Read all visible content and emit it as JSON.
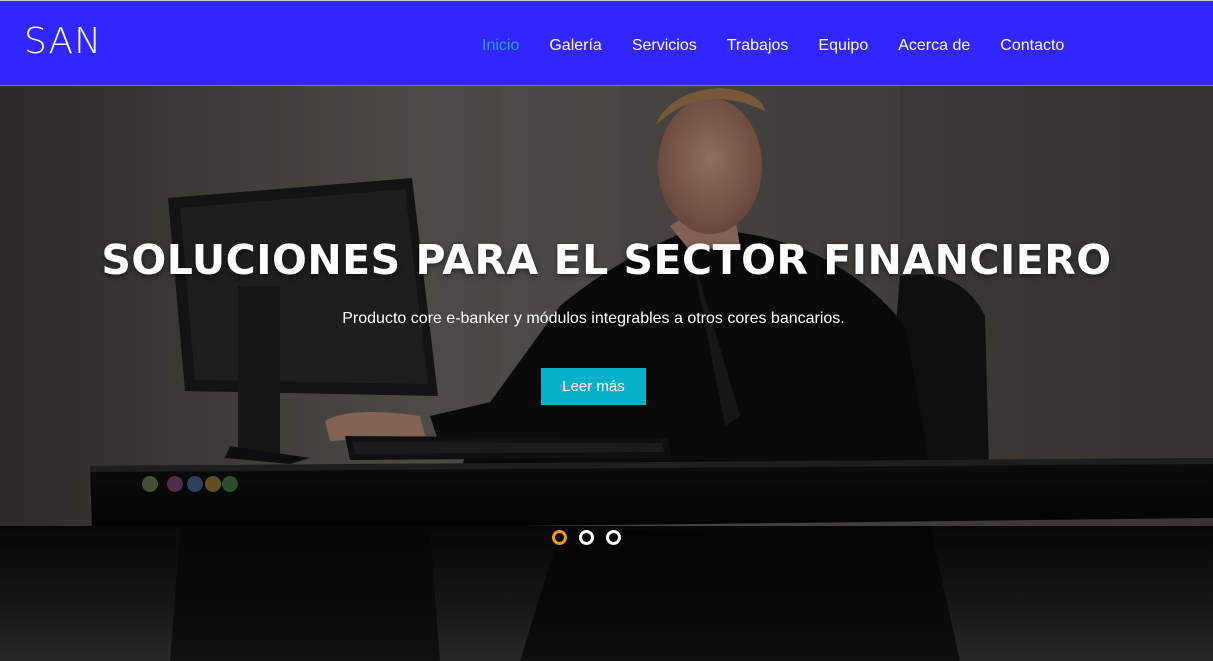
{
  "brand": {
    "name": "SAN"
  },
  "nav": {
    "items": [
      {
        "label": "Inicio",
        "active": true
      },
      {
        "label": "Galería",
        "active": false
      },
      {
        "label": "Servicios",
        "active": false
      },
      {
        "label": "Trabajos",
        "active": false
      },
      {
        "label": "Equipo",
        "active": false
      },
      {
        "label": "Acerca de",
        "active": false
      },
      {
        "label": "Contacto",
        "active": false
      }
    ]
  },
  "hero": {
    "title": "SOLUCIONES PARA EL SECTOR FINANCIERO",
    "subtitle": "Producto core e-banker y módulos integrables a otros cores bancarios.",
    "button_label": "Leer más",
    "slides": {
      "count": 3,
      "active_index": 0
    }
  },
  "colors": {
    "navbar_bg": "#3126fb",
    "active_link": "#1fa6e8",
    "button_bg": "#07b1c9",
    "active_dot": "#f29a16"
  },
  "icons": {
    "slide_indicator": "circle-outline-icon"
  }
}
